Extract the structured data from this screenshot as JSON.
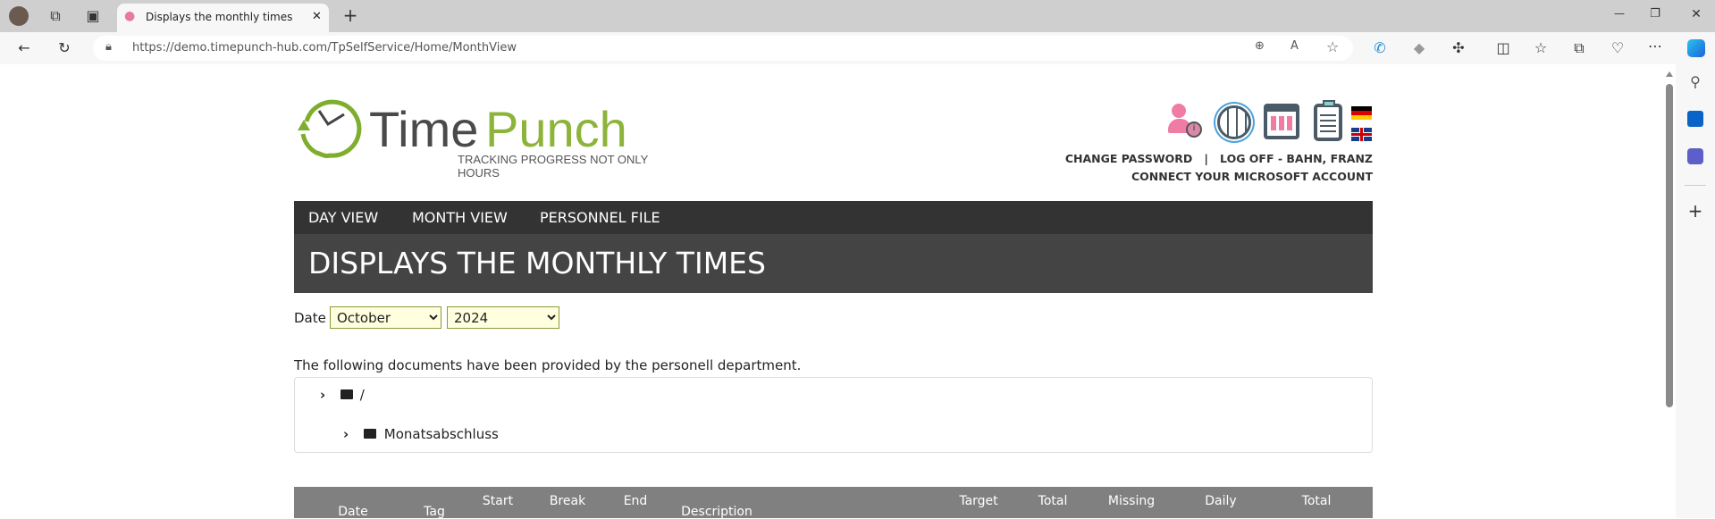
{
  "browser": {
    "tab_title": "Displays the monthly times",
    "url": "https://demo.timepunch-hub.com/TpSelfService/Home/MonthView",
    "new_tab": "+",
    "window_controls": {
      "minimize": "—",
      "restore": "❐",
      "close": "✕"
    }
  },
  "header": {
    "logo_text_dark": "Time",
    "logo_text_green": "Punch",
    "tagline": "TRACKING PROGRESS NOT ONLY HOURS",
    "icons": [
      "user-info-icon",
      "globe-icon",
      "calendar-icon",
      "clipboard-checklist-icon"
    ],
    "languages": [
      "de",
      "en"
    ],
    "change_password": "CHANGE PASSWORD",
    "separator": "|",
    "log_off": "LOG OFF - BAHN, FRANZ",
    "connect_ms": "CONNECT YOUR MICROSOFT ACCOUNT"
  },
  "nav": {
    "items": [
      "DAY VIEW",
      "MONTH VIEW",
      "PERSONNEL FILE"
    ]
  },
  "page_title": "DISPLAYS THE MONTHLY TIMES",
  "date_filter": {
    "label": "Date",
    "month": "October",
    "year": "2024"
  },
  "documents": {
    "intro": "The following documents have been provided by the personell department.",
    "tree": [
      {
        "label": "/",
        "level": 0
      },
      {
        "label": "Monatsabschluss",
        "level": 1
      }
    ]
  },
  "table": {
    "headers": [
      "Date",
      "Tag",
      "Start",
      "Break",
      "End",
      "Description",
      "Target",
      "Total",
      "Missing",
      "Daily",
      "Total"
    ]
  },
  "colors": {
    "accent_green": "#8db43a",
    "nav_bg": "#333333",
    "title_bg": "#444444",
    "table_header_bg": "#808080",
    "select_bg": "#ffffe0"
  }
}
